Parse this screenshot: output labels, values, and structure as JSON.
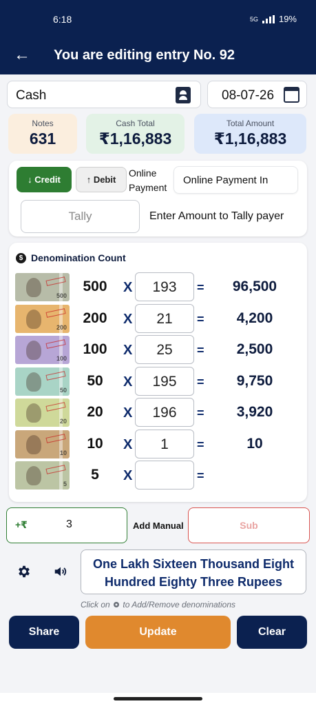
{
  "status_bar": {
    "time": "6:18",
    "network": "5G",
    "battery": "19%"
  },
  "header": {
    "title": "You are editing entry No. 92"
  },
  "account": {
    "name": "Cash",
    "date": "08-07-26"
  },
  "stats": [
    {
      "label": "Notes",
      "value": "631"
    },
    {
      "label": "Cash Total",
      "value": "₹1,16,883"
    },
    {
      "label": "Total Amount",
      "value": "₹1,16,883"
    }
  ],
  "payment": {
    "credit_label": "Credit",
    "debit_label": "Debit",
    "online_label": "Online Payment",
    "online_value": "Online Payment In",
    "tally_placeholder": "Tally",
    "tally_hint": "Enter Amount to Tally payer"
  },
  "denomination": {
    "heading": "Denomination Count",
    "rows": [
      {
        "note": "500",
        "count": "193",
        "total": "96,500",
        "color": "#b7bca8"
      },
      {
        "note": "200",
        "count": "21",
        "total": "4,200",
        "color": "#e7b56e"
      },
      {
        "note": "100",
        "count": "25",
        "total": "2,500",
        "color": "#b7a6d6"
      },
      {
        "note": "50",
        "count": "195",
        "total": "9,750",
        "color": "#a9d4c6"
      },
      {
        "note": "20",
        "count": "196",
        "total": "3,920",
        "color": "#cfd99a"
      },
      {
        "note": "10",
        "count": "1",
        "total": "10",
        "color": "#c9a77a"
      },
      {
        "note": "5",
        "count": "",
        "total": "",
        "color": "#bcc5a4"
      }
    ],
    "times_symbol": "X",
    "equals_symbol": "="
  },
  "manual": {
    "prefix": "+₹",
    "value": "3",
    "add_label": "Add Manual",
    "sub_label": "Sub"
  },
  "amount_in_words": "One  Lakh Sixteen  Thousand Eight Hundred Eighty Three Rupees",
  "hint": {
    "before": "Click on",
    "after": "to Add/Remove denominations"
  },
  "actions": {
    "share": "Share",
    "update": "Update",
    "clear": "Clear"
  },
  "colors": {
    "primary": "#0b2150",
    "credit": "#2e7d32",
    "update": "#e0892e",
    "sub": "#d9534f"
  }
}
